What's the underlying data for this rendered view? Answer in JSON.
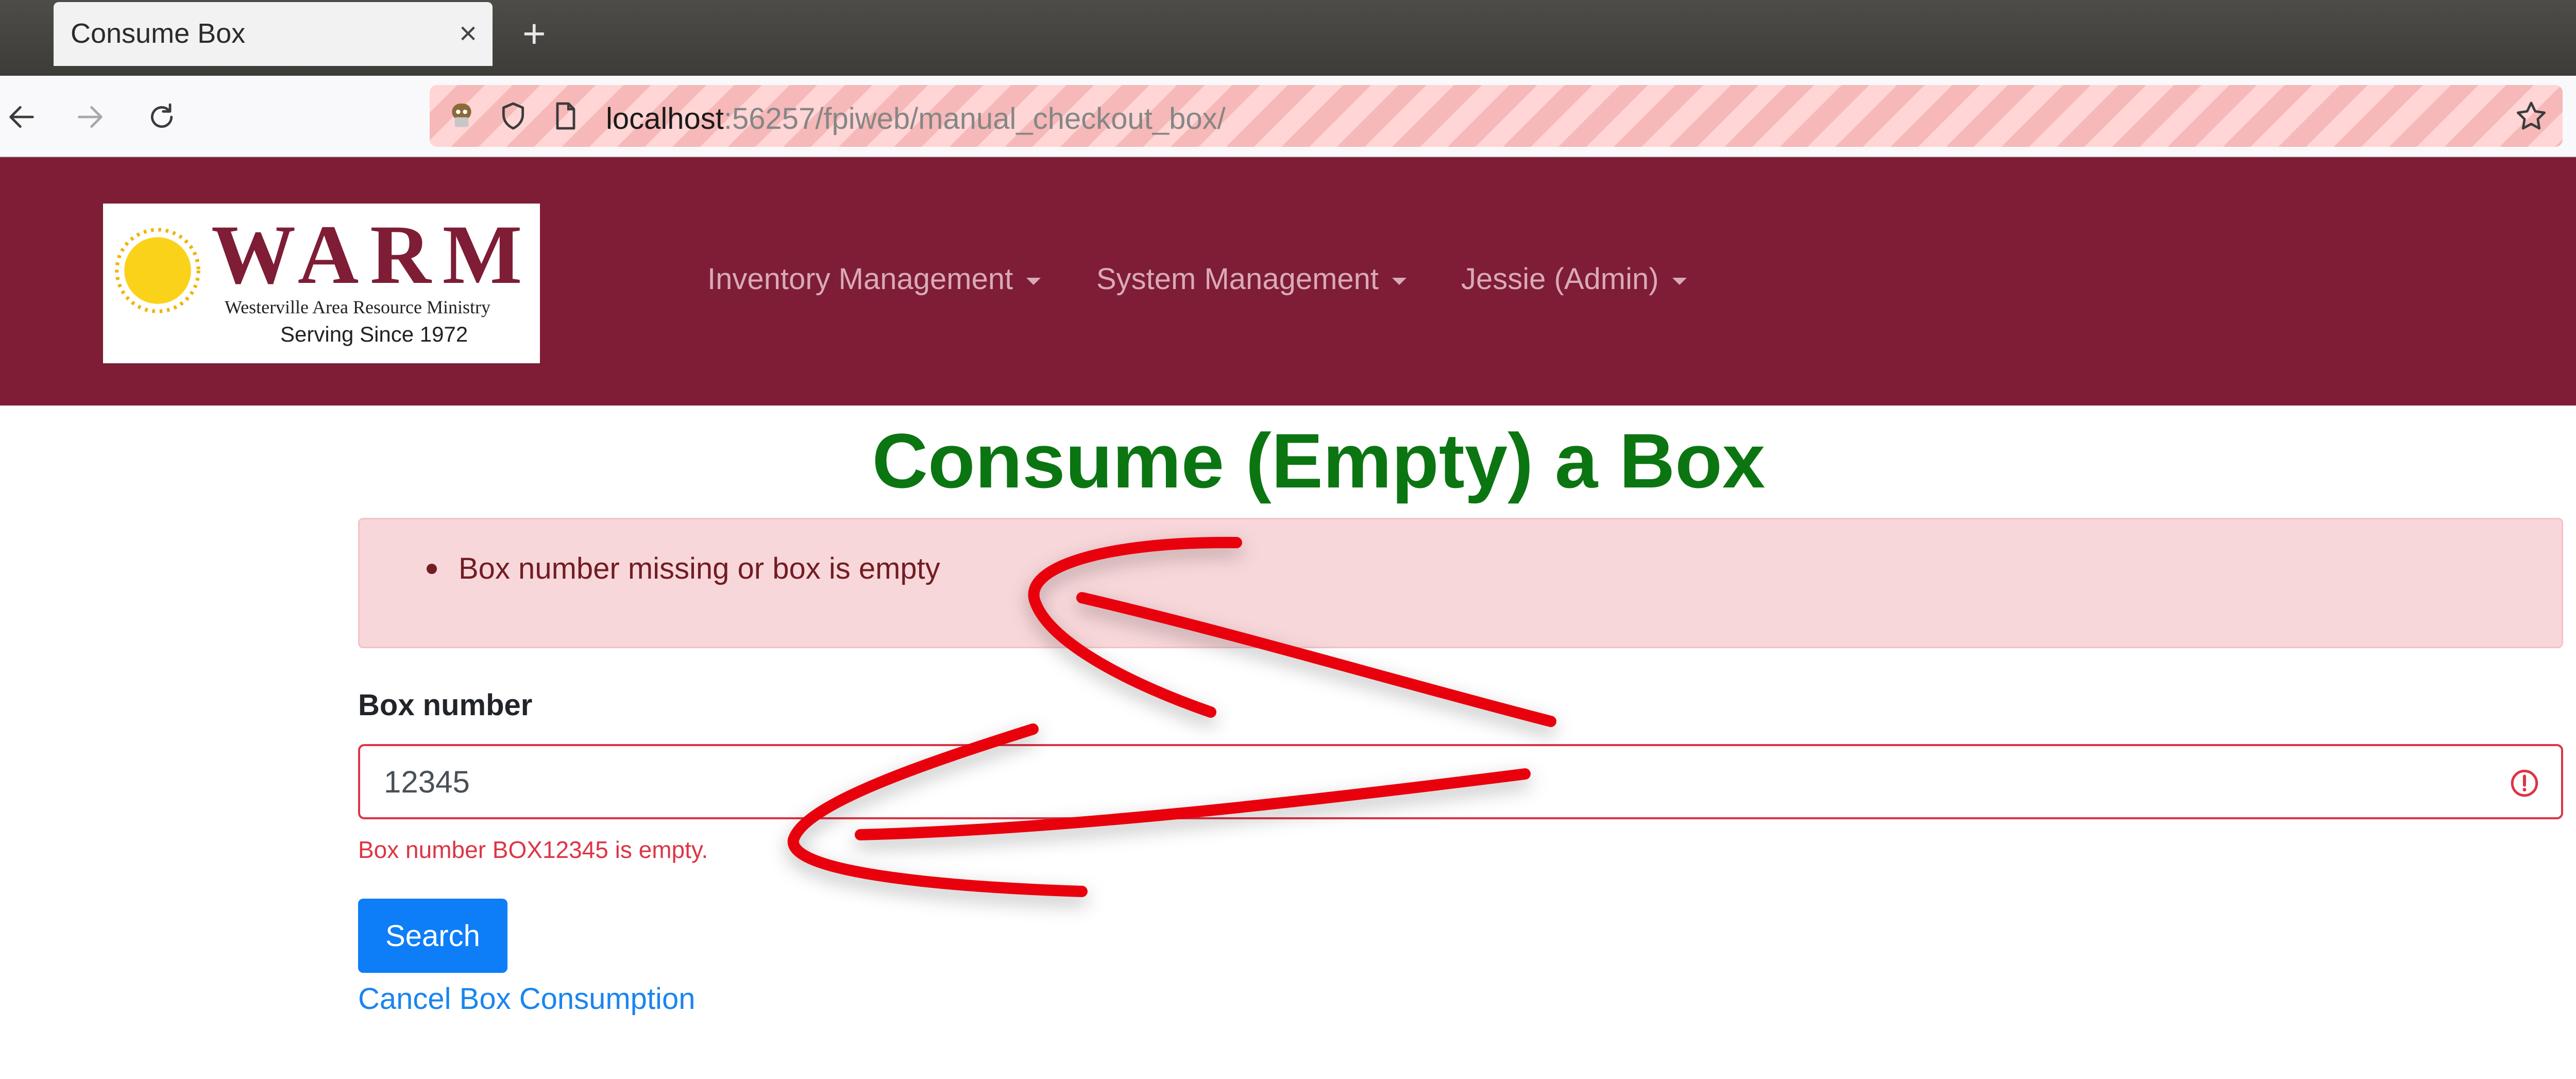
{
  "browser": {
    "tab_title": "Consume Box",
    "tab_close": "×",
    "new_tab": "+",
    "url_host": "localhost",
    "url_rest": ":56257/fpiweb/manual_checkout_box/"
  },
  "site": {
    "logo": {
      "title": "WARM",
      "subtitle": "Westerville Area Resource Ministry",
      "since": "Serving Since 1972"
    },
    "menu": [
      {
        "label": "Inventory Management"
      },
      {
        "label": "System Management"
      },
      {
        "label": "Jessie (Admin)"
      }
    ]
  },
  "page": {
    "title": "Consume (Empty) a Box",
    "alert_items": [
      "Box number missing or box is empty"
    ],
    "form": {
      "box_label": "Box number",
      "box_value": "12345",
      "error_message": "Box number BOX12345 is empty.",
      "search_label": "Search",
      "cancel_label": "Cancel Box Consumption"
    }
  },
  "colors": {
    "header_bg": "#7e1d35",
    "title_green": "#0b7512",
    "error_red": "#dc3545",
    "button_blue": "#0d7ef7",
    "annotation_red": "#e8000b"
  },
  "icons": [
    "back-icon",
    "forward-icon",
    "reload-icon",
    "tracking-icon",
    "shield-icon",
    "page-icon",
    "star-icon",
    "error-icon"
  ]
}
